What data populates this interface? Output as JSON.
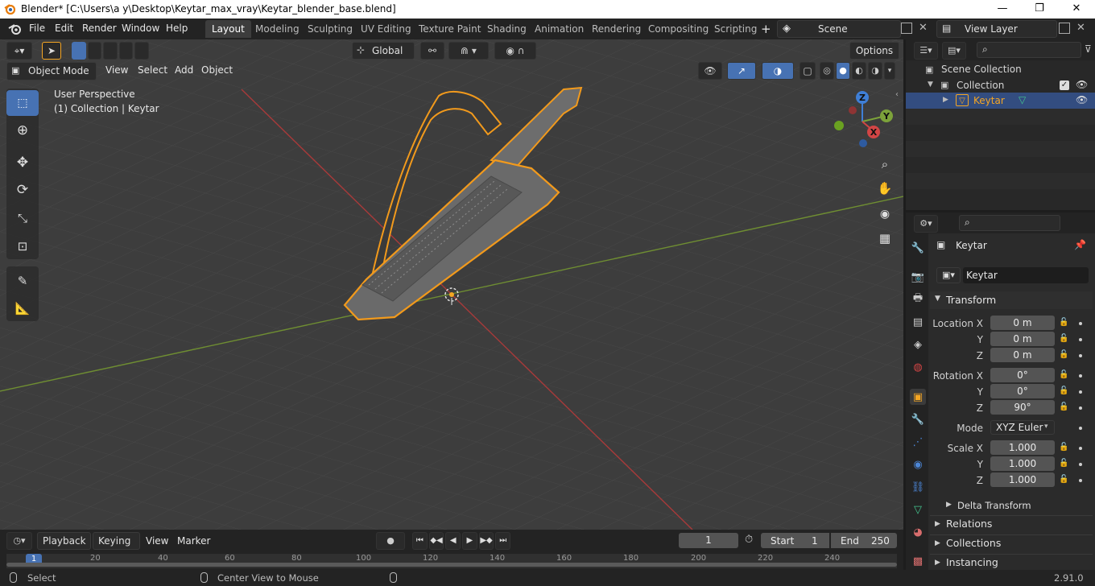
{
  "window": {
    "title": "Blender* [C:\\Users\\a y\\Desktop\\Keytar_max_vray\\Keytar_blender_base.blend]",
    "minimize": "—",
    "maximize": "❐",
    "close": "✕"
  },
  "menu": [
    "File",
    "Edit",
    "Render",
    "Window",
    "Help"
  ],
  "workspaces": [
    "Layout",
    "Modeling",
    "Sculpting",
    "UV Editing",
    "Texture Paint",
    "Shading",
    "Animation",
    "Rendering",
    "Compositing",
    "Scripting"
  ],
  "active_workspace": "Layout",
  "add_workspace": "+",
  "scene": "Scene",
  "view_layer": "View Layer",
  "viewport": {
    "transform_orientation": "Global",
    "options": "Options",
    "mode": "Object Mode",
    "menus": [
      "View",
      "Select",
      "Add",
      "Object"
    ],
    "overlay_title": "User Perspective",
    "overlay_subtitle": "(1) Collection | Keytar",
    "gizmo": {
      "z": "Z",
      "y": "Y",
      "x": "X"
    }
  },
  "outliner": {
    "items": [
      "Scene Collection",
      "Collection",
      "Keytar"
    ]
  },
  "properties": {
    "object_name": "Keytar",
    "datablock_name": "Keytar",
    "transform_header": "Transform",
    "location": {
      "label_x": "Location X",
      "label_y": "Y",
      "label_z": "Z",
      "x": "0 m",
      "y": "0 m",
      "z": "0 m"
    },
    "rotation": {
      "label_x": "Rotation X",
      "label_y": "Y",
      "label_z": "Z",
      "x": "0°",
      "y": "0°",
      "z": "90°"
    },
    "mode_label": "Mode",
    "mode_value": "XYZ Euler",
    "scale": {
      "label_x": "Scale X",
      "label_y": "Y",
      "label_z": "Z",
      "x": "1.000",
      "y": "1.000",
      "z": "1.000"
    },
    "delta_transform": "Delta Transform",
    "sections": [
      "Relations",
      "Collections",
      "Instancing"
    ]
  },
  "timeline": {
    "menus": [
      "Playback",
      "Keying",
      "View",
      "Marker"
    ],
    "current_frame": "1",
    "start_label": "Start",
    "start": "1",
    "end_label": "End",
    "end": "250",
    "ruler": [
      "1",
      "20",
      "40",
      "60",
      "80",
      "100",
      "120",
      "140",
      "160",
      "180",
      "200",
      "220",
      "240"
    ]
  },
  "status": {
    "left": "Select",
    "middle": "Center View to Mouse",
    "version": "2.91.0"
  },
  "colors": {
    "accent_blue": "#4772b3",
    "selection_orange": "#f5a623",
    "x_axis": "#d24545",
    "y_axis": "#7ca23a",
    "z_axis": "#3f7fd6"
  }
}
